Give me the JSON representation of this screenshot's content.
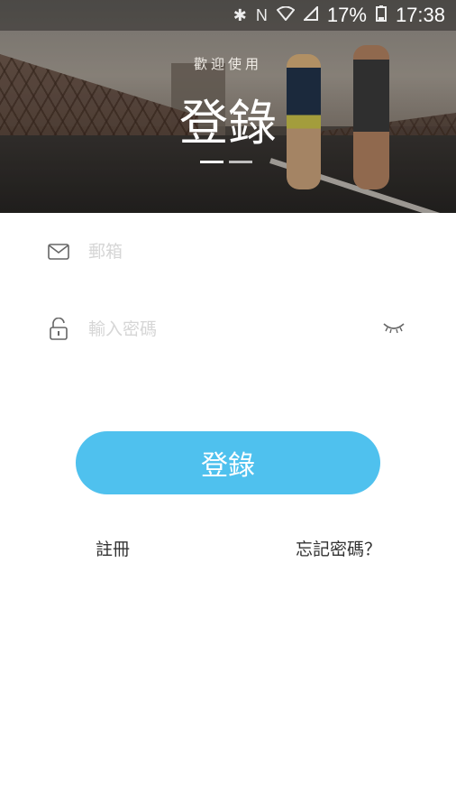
{
  "status_bar": {
    "battery_percent": "17%",
    "time": "17:38",
    "icons": [
      "bluetooth-icon",
      "nfc-icon",
      "wifi-icon",
      "signal-icon",
      "battery-icon"
    ]
  },
  "header": {
    "welcome": "歡迎使用",
    "title": "登錄"
  },
  "form": {
    "email_placeholder": "郵箱",
    "password_placeholder": "輸入密碼",
    "email_icon": "mail-icon",
    "password_icon": "lock-icon",
    "toggle_icon": "eye-closed-icon"
  },
  "actions": {
    "login_label": "登錄",
    "register_label": "註冊",
    "forgot_label": "忘記密碼？"
  },
  "colors": {
    "accent": "#4fc1ee",
    "text": "#333333",
    "placeholder": "#d6d6d6"
  }
}
